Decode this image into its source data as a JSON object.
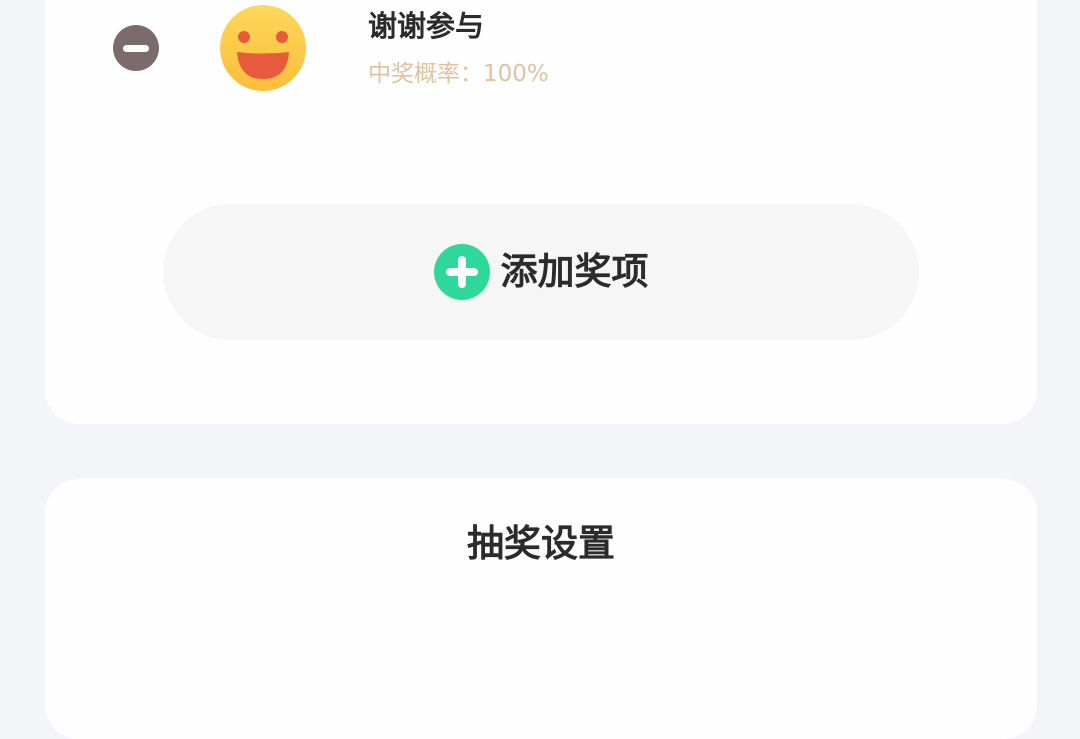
{
  "prize_item": {
    "name": "谢谢参与",
    "probability": "中奖概率：100%",
    "remove_icon": "minus-circle-icon",
    "emoji_icon": "grinning-face-icon"
  },
  "add_prize": {
    "label": "添加奖项",
    "icon": "plus-circle-icon"
  },
  "settings_section": {
    "title": "抽奖设置"
  },
  "colors": {
    "page_background": "#f4f5f9",
    "card_background": "#fefefe",
    "remove_button": "#7c6b6c",
    "probability_text": "#e0c1a0",
    "add_icon_green": "#2ed89a",
    "emoji_yellow": "#fcc945",
    "emoji_mouth": "#e75a3c",
    "primary_text": "#2b2b2b"
  }
}
